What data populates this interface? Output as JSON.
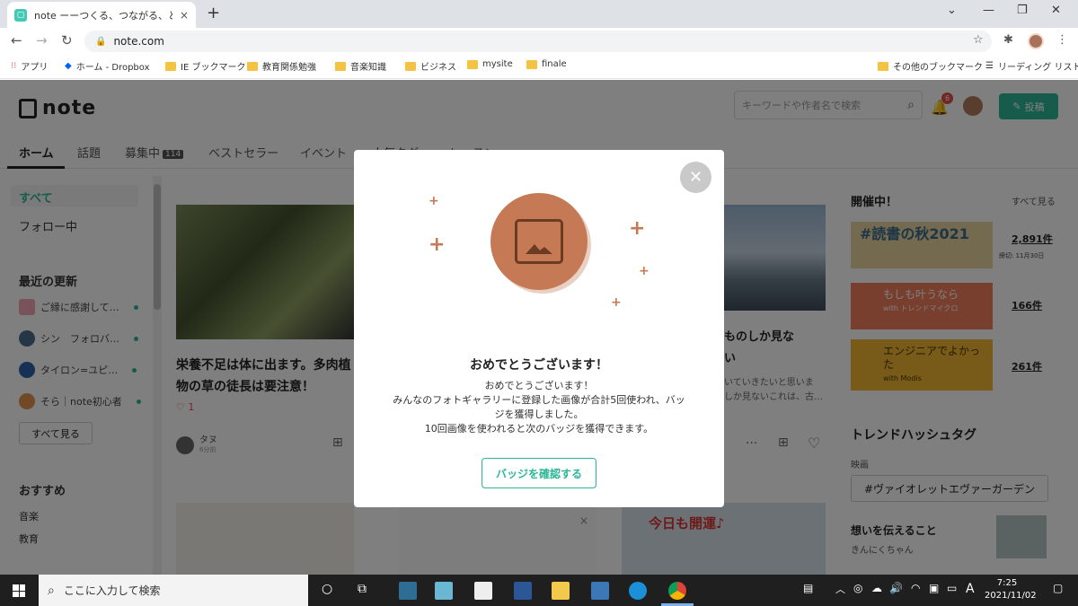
{
  "browser": {
    "tab_title": "note ーーつくる、つながる、とどける。",
    "tab_close": "×",
    "new_tab": "+",
    "url": "note.com",
    "minimize": "⌄",
    "win_min": "—",
    "win_max": "❐",
    "win_close": "✕"
  },
  "bookmarks": [
    {
      "label": "アプリ"
    },
    {
      "label": "ホーム - Dropbox"
    },
    {
      "label": "IE ブックマーク"
    },
    {
      "label": "教育関係勉強"
    },
    {
      "label": "音楽知識"
    },
    {
      "label": "ビジネス"
    },
    {
      "label": "mysite"
    },
    {
      "label": "finale"
    },
    {
      "label": "その他のブックマーク"
    },
    {
      "label": "リーディング リスト"
    }
  ],
  "header": {
    "logo": "note",
    "search_placeholder": "キーワードや作者名で検索",
    "notif_count": "6",
    "post_label": "投稿"
  },
  "nav": {
    "tabs": [
      "ホーム",
      "話題",
      "募集中",
      "ベストセラー",
      "イベント",
      "人気タグ",
      "レッスン"
    ],
    "recruit_count": "114"
  },
  "sidebar": {
    "all": "すべて",
    "following": "フォロー中",
    "recent_heading": "最近の更新",
    "updates": [
      "ご縁に感謝して…",
      "シン　フォロバ…",
      "タイロン=ユピ…",
      "そら｜note初心者"
    ],
    "see_all": "すべて見る",
    "recommend_heading": "おすすめ",
    "recommend": [
      "音楽",
      "教育"
    ]
  },
  "card1": {
    "title": "栄養不足は体に出ます。多肉植物の草の徒長は要注意！",
    "likes": "1",
    "author": "タヌ",
    "time": "6分前"
  },
  "card2": {
    "title_line1": "ものしか見な",
    "title_line2": "い",
    "excerpt1": "いていきたいと思いま",
    "excerpt2": "しか見ないこれは、古…"
  },
  "bottom_banner": "今日も開運♪",
  "right_panel": {
    "events_heading": "開催中！",
    "see_all": "すべて見る",
    "events": [
      {
        "name": "#読書の秋2021",
        "count": "2,891件",
        "sub": "締切: 11月30日",
        "color": "#e9d5a0"
      },
      {
        "name": "もしも叶うなら",
        "sponsor": "with トレンドマイクロ",
        "count": "166件",
        "color": "#f07d5d"
      },
      {
        "name": "エンジニアでよかった",
        "sponsor": "with Modis",
        "count": "261件",
        "color": "#f2b632"
      }
    ],
    "trend_heading": "トレンドハッシュタグ",
    "trend_category": "映画",
    "trend_tag": "#ヴァイオレットエヴァーガーデン",
    "article_title": "想いを伝えること",
    "article_author": "きんにくちゃん"
  },
  "modal": {
    "title": "おめでとうございます！",
    "line1": "おめでとうございます！",
    "line2": "みんなのフォトギャラリーに登録した画像が合計5回使われ、バッ",
    "line3": "ジを獲得しました。",
    "line4": "10回画像を使われると次のバッジを獲得できます。",
    "button": "バッジを確認する",
    "accent": "#c57a55",
    "button_color": "#2cb696"
  },
  "taskbar": {
    "search_placeholder": "ここに入力して検索",
    "ime": "A",
    "time": "7:25",
    "date": "2021/11/02"
  }
}
